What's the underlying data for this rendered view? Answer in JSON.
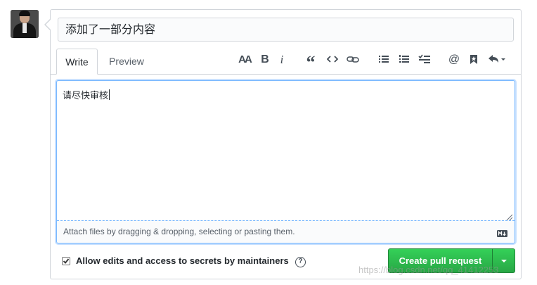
{
  "title_field": {
    "value": "添加了一部分内容"
  },
  "tabs": [
    {
      "label": "Write",
      "active": true
    },
    {
      "label": "Preview",
      "active": false
    }
  ],
  "toolbar": {
    "header_glyph": "AA",
    "bold_glyph": "B",
    "italic_glyph": "i",
    "quote_glyph": "“",
    "mention_glyph": "@",
    "icons": [
      "header-icon",
      "bold-icon",
      "italic-icon",
      "quote-icon",
      "code-icon",
      "link-icon",
      "bullet-list-icon",
      "numbered-list-icon",
      "task-list-icon",
      "mention-icon",
      "saved-reply-icon",
      "reply-arrow-icon"
    ]
  },
  "editor": {
    "value": "请尽快审核",
    "drop_hint": "Attach files by dragging & dropping, selecting or pasting them."
  },
  "allow_edits": {
    "label": "Allow edits and access to secrets by maintainers",
    "checked": true,
    "help_glyph": "?"
  },
  "submit": {
    "label": "Create pull request"
  },
  "watermark": "https://blog.csdn.net/qq_41412253",
  "colors": {
    "accent": "#28a745",
    "focus": "#79b8ff",
    "border": "#d1d5da"
  }
}
